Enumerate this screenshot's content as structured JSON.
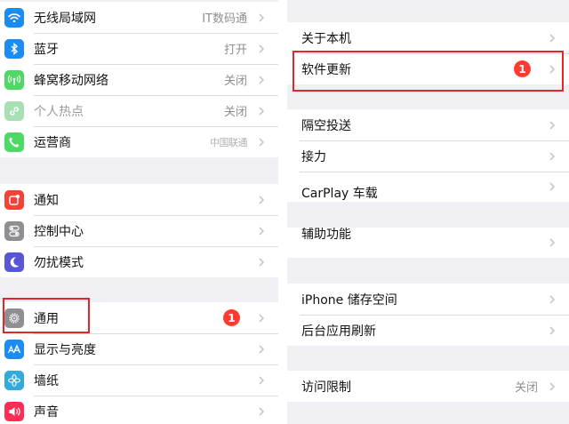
{
  "left": {
    "group1": [
      {
        "label": "无线局域网",
        "value": "IT数码通",
        "icon": "wifi-icon",
        "color": "#1a8cf3"
      },
      {
        "label": "蓝牙",
        "value": "打开",
        "icon": "bluetooth-icon",
        "color": "#1a8cf3"
      },
      {
        "label": "蜂窝移动网络",
        "value": "关闭",
        "icon": "antenna-icon",
        "color": "#4cd964"
      },
      {
        "label": "个人热点",
        "value": "关闭",
        "icon": "hotspot-icon",
        "color": "#a8dfb3"
      },
      {
        "label": "运营商",
        "value": "中国联通",
        "icon": "phone-icon",
        "color": "#4cd964"
      }
    ],
    "group2": [
      {
        "label": "通知",
        "icon": "notification-icon",
        "color": "#f44336"
      },
      {
        "label": "控制中心",
        "icon": "control-center-icon",
        "color": "#8e8e93"
      },
      {
        "label": "勿扰模式",
        "icon": "moon-icon",
        "color": "#5856d6"
      }
    ],
    "group3": [
      {
        "label": "通用",
        "badge": "1",
        "icon": "gear-icon",
        "color": "#8e8e93"
      },
      {
        "label": "显示与亮度",
        "icon": "text-size-icon",
        "color": "#1a8cf3"
      },
      {
        "label": "墙纸",
        "icon": "flower-icon",
        "color": "#34aadc"
      },
      {
        "label": "声音",
        "icon": "speaker-icon",
        "color": "#ff2d55"
      }
    ]
  },
  "right": {
    "group1": [
      {
        "label": "关于本机"
      },
      {
        "label": "软件更新",
        "badge": "1"
      }
    ],
    "group2": [
      {
        "label": "隔空投送"
      },
      {
        "label": "接力"
      },
      {
        "label": "CarPlay 车载"
      }
    ],
    "group3": [
      {
        "label": "辅助功能"
      }
    ],
    "group4": [
      {
        "label": "iPhone 储存空间"
      },
      {
        "label": "后台应用刷新"
      }
    ],
    "group5": [
      {
        "label": "访问限制",
        "value": "关闭"
      }
    ]
  },
  "colors": {
    "accent": "#1a8cf3",
    "badge": "#ff3b30",
    "highlight_box": "#e4262b"
  }
}
